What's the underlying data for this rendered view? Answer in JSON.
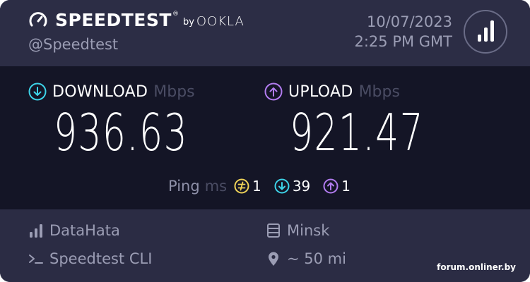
{
  "header": {
    "brand": "SPEEDTEST",
    "trademark": "®",
    "by": "by",
    "company": "OOKLA",
    "handle": "@Speedtest",
    "date": "10/07/2023",
    "time": "2:25 PM GMT",
    "results_icon": "bar-chart-icon"
  },
  "download": {
    "label": "DOWNLOAD",
    "unit": "Mbps",
    "value": "936.63",
    "icon": "arrow-down-circle-icon",
    "color": "#3dd3e8"
  },
  "upload": {
    "label": "UPLOAD",
    "unit": "Mbps",
    "value": "921.47",
    "icon": "arrow-up-circle-icon",
    "color": "#b27cf0"
  },
  "ping": {
    "label": "Ping",
    "unit": "ms",
    "idle": {
      "value": "1",
      "icon": "jitter-circle-icon",
      "color": "#f0d458"
    },
    "download": {
      "value": "39",
      "icon": "arrow-down-circle-icon",
      "color": "#3dd3e8"
    },
    "upload": {
      "value": "1",
      "icon": "arrow-up-circle-icon",
      "color": "#b27cf0"
    }
  },
  "footer": {
    "isp": {
      "text": "DataHata",
      "icon": "signal-bars-icon"
    },
    "server": {
      "text": "Minsk",
      "icon": "server-icon"
    },
    "client": {
      "text": "Speedtest CLI",
      "icon": "terminal-icon"
    },
    "distance": {
      "text": "~ 50 mi",
      "icon": "map-pin-icon"
    }
  },
  "watermark": "forum.onliner.by"
}
